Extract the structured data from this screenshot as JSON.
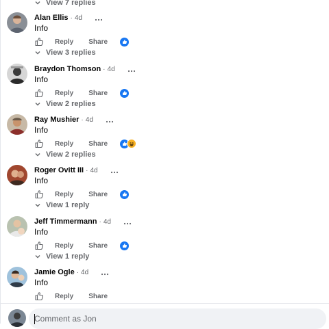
{
  "threads": [
    {
      "replies_label": "View 7 replies"
    },
    {
      "author": "Alan Ellis",
      "time": "4d",
      "text": "Info",
      "reply_label": "Reply",
      "share_label": "Share",
      "reactions": [
        "like"
      ],
      "replies_label": "View 3 replies"
    },
    {
      "author": "Braydon Thomson",
      "time": "4d",
      "text": "Info",
      "reply_label": "Reply",
      "share_label": "Share",
      "reactions": [
        "like"
      ],
      "replies_label": "View 2 replies"
    },
    {
      "author": "Ray Mushier",
      "time": "4d",
      "text": "Info",
      "reply_label": "Reply",
      "share_label": "Share",
      "reactions": [
        "like",
        "haha"
      ],
      "replies_label": "View 2 replies"
    },
    {
      "author": "Roger Ovitt III",
      "time": "4d",
      "text": "Info",
      "reply_label": "Reply",
      "share_label": "Share",
      "reactions": [
        "like"
      ],
      "replies_label": "View 1 reply"
    },
    {
      "author": "Jeff Timmermann",
      "time": "4d",
      "text": "Info",
      "reply_label": "Reply",
      "share_label": "Share",
      "reactions": [
        "like"
      ],
      "replies_label": "View 1 reply"
    },
    {
      "author": "Jamie Ogle",
      "time": "4d",
      "text": "Info",
      "reply_label": "Reply",
      "share_label": "Share",
      "reactions": []
    }
  ],
  "composer": {
    "placeholder": "Comment as Jon"
  },
  "colors": {
    "like_blue": "#1877f2",
    "muted_text": "#65676b",
    "composer_bg": "#f0f2f5",
    "haha_yellow": "#f7b125"
  },
  "icons": [
    "chevron-down-icon",
    "thumbs-up-icon",
    "more-options-icon",
    "like-reaction-icon",
    "haha-reaction-icon"
  ]
}
